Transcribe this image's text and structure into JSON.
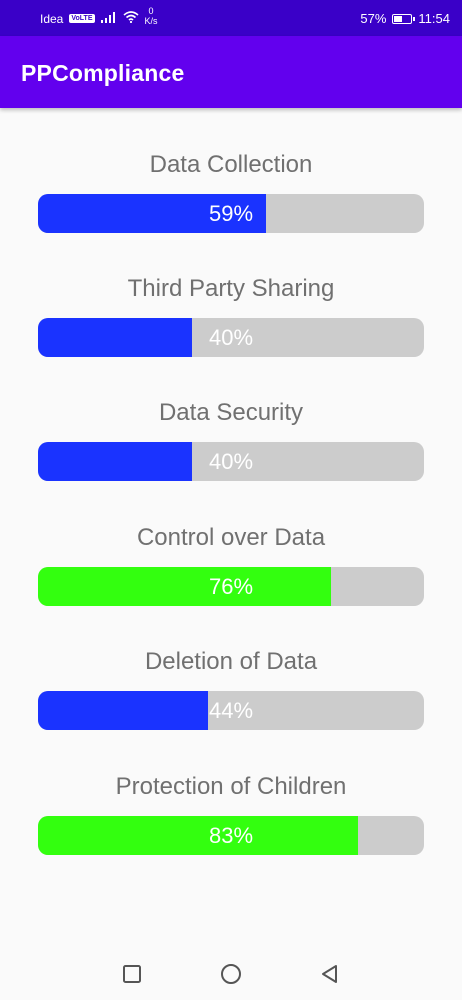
{
  "status_bar": {
    "carrier": "Idea",
    "volte_badge": "VoLTE",
    "net_speed_value": "0",
    "net_speed_unit": "K/s",
    "battery_percent": "57%",
    "battery_level": 0.57,
    "time": "11:54",
    "icons": [
      "signal-icon",
      "wifi-icon",
      "battery-icon"
    ]
  },
  "app_bar": {
    "title": "PPCompliance"
  },
  "metrics": [
    {
      "label": "Data Collection",
      "percent_text": "59%",
      "value": 59,
      "color": "#1a33ff"
    },
    {
      "label": "Third Party Sharing",
      "percent_text": "40%",
      "value": 40,
      "color": "#1a33ff"
    },
    {
      "label": "Data Security",
      "percent_text": "40%",
      "value": 40,
      "color": "#1a33ff"
    },
    {
      "label": "Control over Data",
      "percent_text": "76%",
      "value": 76,
      "color": "#33ff0f"
    },
    {
      "label": "Deletion of Data",
      "percent_text": "44%",
      "value": 44,
      "color": "#1a33ff"
    },
    {
      "label": "Protection of Children",
      "percent_text": "83%",
      "value": 83,
      "color": "#33ff0f"
    }
  ],
  "nav_bar": {
    "icons": [
      "recents-square-icon",
      "home-circle-icon",
      "back-triangle-icon"
    ]
  },
  "colors": {
    "status_bar": "#3a00c8",
    "app_bar": "#6200ee",
    "track": "#cccccc",
    "label_text": "#707070",
    "background": "#fafafa"
  }
}
